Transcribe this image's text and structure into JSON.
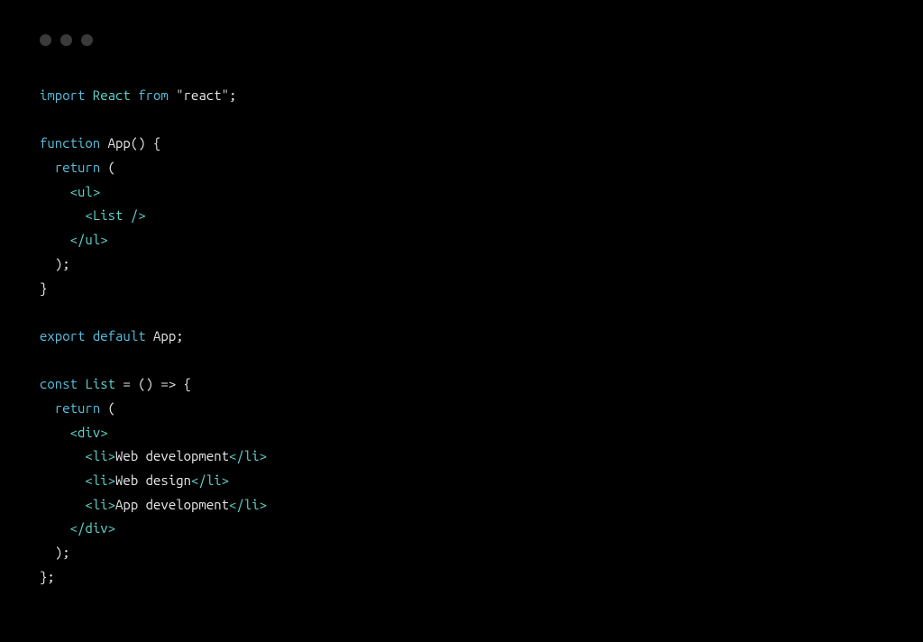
{
  "code": {
    "l1": {
      "import": "import",
      "react": "React",
      "from": "from",
      "str": "\"react\"",
      "semi": ";"
    },
    "l3": {
      "function": "function",
      "app": "App",
      "parens": "()",
      "space": " ",
      "brace": "{"
    },
    "l4": {
      "indent": "  ",
      "return": "return",
      "paren": " ("
    },
    "l5": {
      "indent": "    ",
      "open": "<",
      "ul": "ul",
      "close": ">"
    },
    "l6": {
      "indent": "      ",
      "open": "<",
      "list": "List",
      "slash": " /",
      "close": ">"
    },
    "l7": {
      "indent": "    ",
      "open": "</",
      "ul": "ul",
      "close": ">"
    },
    "l8": {
      "indent": "  ",
      "paren": ");"
    },
    "l9": {
      "brace": "}"
    },
    "l11": {
      "export": "export",
      "default": "default",
      "app": "App",
      "semi": ";"
    },
    "l13": {
      "const": "const",
      "list": "List",
      "eq": " = ",
      "arrow": "() => {"
    },
    "l14": {
      "indent": "  ",
      "return": "return",
      "paren": " ("
    },
    "l15": {
      "indent": "    ",
      "open": "<",
      "div": "div",
      "close": ">"
    },
    "l16": {
      "indent": "      ",
      "open": "<",
      "li": "li",
      "close": ">",
      "text": "Web development",
      "open2": "</",
      "li2": "li",
      "close2": ">"
    },
    "l17": {
      "indent": "      ",
      "open": "<",
      "li": "li",
      "close": ">",
      "text": "Web design",
      "open2": "</",
      "li2": "li",
      "close2": ">"
    },
    "l18": {
      "indent": "      ",
      "open": "<",
      "li": "li",
      "close": ">",
      "text": "App development",
      "open2": "</",
      "li2": "li",
      "close2": ">"
    },
    "l19": {
      "indent": "    ",
      "open": "</",
      "div": "div",
      "close": ">"
    },
    "l20": {
      "indent": "  ",
      "paren": ");"
    },
    "l21": {
      "brace": "};"
    }
  }
}
